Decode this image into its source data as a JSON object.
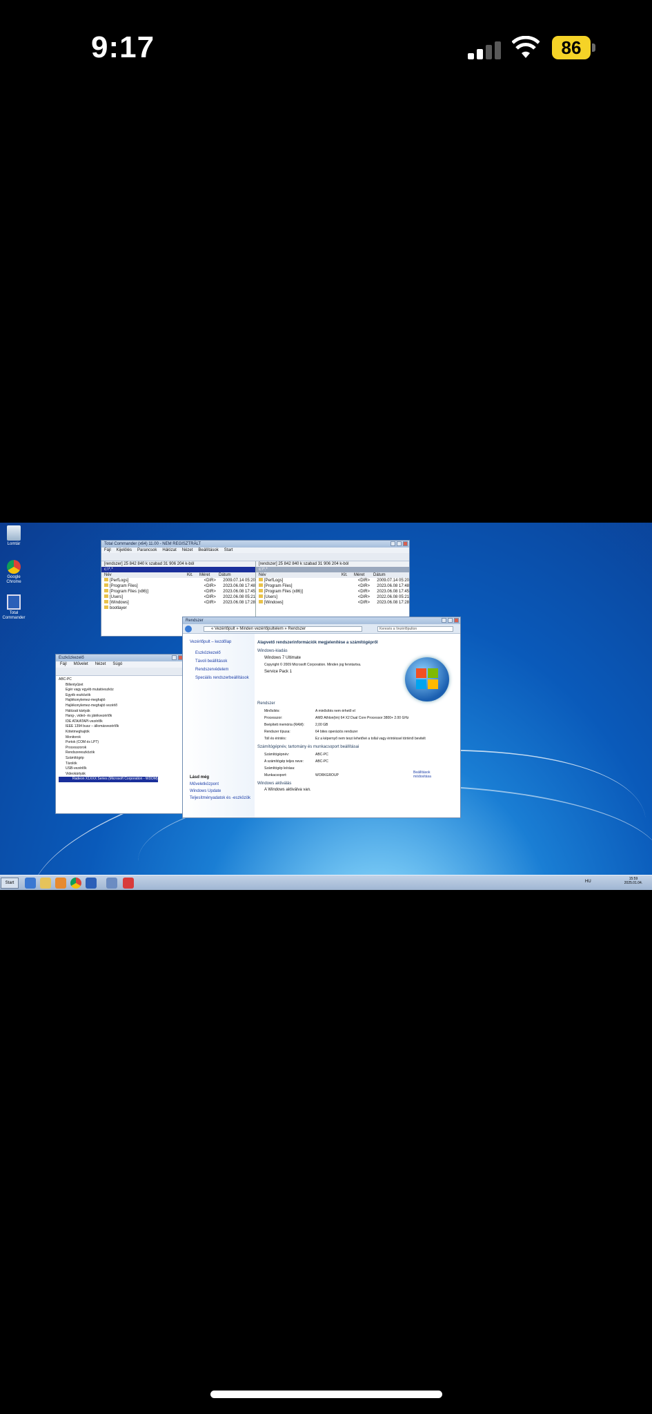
{
  "status_bar": {
    "time": "9:17",
    "battery": "86"
  },
  "desktop": {
    "icons": [
      {
        "label": "Lomtár"
      },
      {
        "label": "Google Chrome"
      },
      {
        "label": "Total Commander"
      }
    ],
    "total_commander": {
      "title": "Total Commander (x64) 11.00 - NEM REGISZTRÁLT",
      "menu": [
        "Fájl",
        "Kijelölés",
        "Parancsok",
        "Hálózat",
        "Nézet",
        "Beállítások",
        "Start"
      ],
      "left_free": "[rendszer]  25 842 840 k szabad 31 906 204 k-ból",
      "right_free": "[rendszer]  25 842 840 k szabad 31 906 204 k-ból",
      "left_path": "c:\\*.*",
      "right_path": "c:\\*.*",
      "columns": [
        "Név",
        "Kit.",
        "Méret",
        "Dátum"
      ],
      "left_rows": [
        {
          "name": "[PerfLogs]",
          "size": "<DIR>",
          "date": "2009.07.14 05:20"
        },
        {
          "name": "[Program Files]",
          "size": "<DIR>",
          "date": "2023.06.08 17:48"
        },
        {
          "name": "[Program Files (x86)]",
          "size": "<DIR>",
          "date": "2023.06.08 17:45"
        },
        {
          "name": "[Users]",
          "size": "<DIR>",
          "date": "2022.06.08 05:21"
        },
        {
          "name": "[Windows]",
          "size": "<DIR>",
          "date": "2023.06.08 17:28"
        },
        {
          "name": "bootlayer",
          "size": "",
          "date": ""
        }
      ],
      "right_rows": [
        {
          "name": "[PerfLogs]",
          "size": "<DIR>",
          "date": "2009.07.14 05:20"
        },
        {
          "name": "[Program Files]",
          "size": "<DIR>",
          "date": "2023.06.08 17:48"
        },
        {
          "name": "[Program Files (x86)]",
          "size": "<DIR>",
          "date": "2023.06.08 17:45"
        },
        {
          "name": "[Users]",
          "size": "<DIR>",
          "date": "2022.06.08 05:21"
        },
        {
          "name": "[Windows]",
          "size": "<DIR>",
          "date": "2023.06.08 17:28"
        }
      ]
    },
    "system": {
      "title": "Rendszer",
      "breadcrumb": "« Vezérlőpult » Minden vezérlőpultelem » Rendszer",
      "search_placeholder": "Keresés a Vezérlőpulton",
      "side_links": [
        "Vezérlőpult – kezdőlap",
        "Eszközkezelő",
        "Távoli beállítások",
        "Rendszervédelem",
        "Speciális rendszerbeállítások"
      ],
      "see_also_title": "Lásd még",
      "see_also": [
        "Műveletközpont",
        "Windows Update",
        "Teljesítményadatok és -eszközök"
      ],
      "heading": "Alapvető rendszerinformációk megjelenítése a számítógépről",
      "edition_title": "Windows-kiadás",
      "edition": "Windows 7 Ultimate",
      "copyright": "Copyright © 2009 Microsoft Corporation. Minden jog fenntartva.",
      "service_pack": "Service Pack 1",
      "system_title": "Rendszer",
      "props": [
        {
          "label": "Minősítés:",
          "value": "A minősítés nem érhető el"
        },
        {
          "label": "Processzor:",
          "value": "AMD Athlon(tm) 64 X2 Dual Core Processor 3800+  2.00 GHz"
        },
        {
          "label": "Beépített memória (RAM):",
          "value": "2,00 GB"
        },
        {
          "label": "Rendszer típusa:",
          "value": "64 bites operációs rendszer"
        },
        {
          "label": "Toll és érintés:",
          "value": "Ez a képernyő nem teszi lehetővé a tollal vagy érintéssel történő bevitelt"
        }
      ],
      "computer_title": "Számítógépnév, tartomány és munkacsoport beállításai",
      "computer": [
        {
          "label": "Számítógépnév:",
          "value": "ABC-PC"
        },
        {
          "label": "A számítógép teljes neve:",
          "value": "ABC-PC"
        },
        {
          "label": "Számítógép leírása:",
          "value": ""
        },
        {
          "label": "Munkacsoport:",
          "value": "WORKGROUP"
        }
      ],
      "change_settings": "Beállítások módosítása",
      "activation_title": "Windows aktiválás",
      "activation": "A Windows aktiválva van."
    },
    "device_manager": {
      "title": "Eszközkezelő",
      "menu": [
        "Fájl",
        "Művelet",
        "Nézet",
        "Súgó"
      ],
      "items": [
        "ABC-PC",
        "Billentyűzet",
        "Egér vagy egyéb mutatóeszköz",
        "Egyéb eszközök",
        "Hajlékonylemez-meghajtó",
        "Hajlékonylemez-meghajtó vezérlő",
        "Hálózati kártyák",
        "Hang-, videó- és játékvezérlők",
        "IDE ATA/ATAPI-vezérlők",
        "IEEE 1394 busz – állomásvezérlők",
        "Kötetmeghajtók",
        "Monitorok",
        "Portok (COM és LPT)",
        "Processzorok",
        "Rendszereszközök",
        "Számítógép",
        "Tárolók",
        "USB-vezérlők",
        "Videokártyák",
        "Radeon X1XXX Series (Microsoft Corporation - WDDM)"
      ]
    },
    "taskbar": {
      "start": "Start",
      "lang": "HU",
      "time": "15:59",
      "date": "2025.01.04."
    }
  }
}
